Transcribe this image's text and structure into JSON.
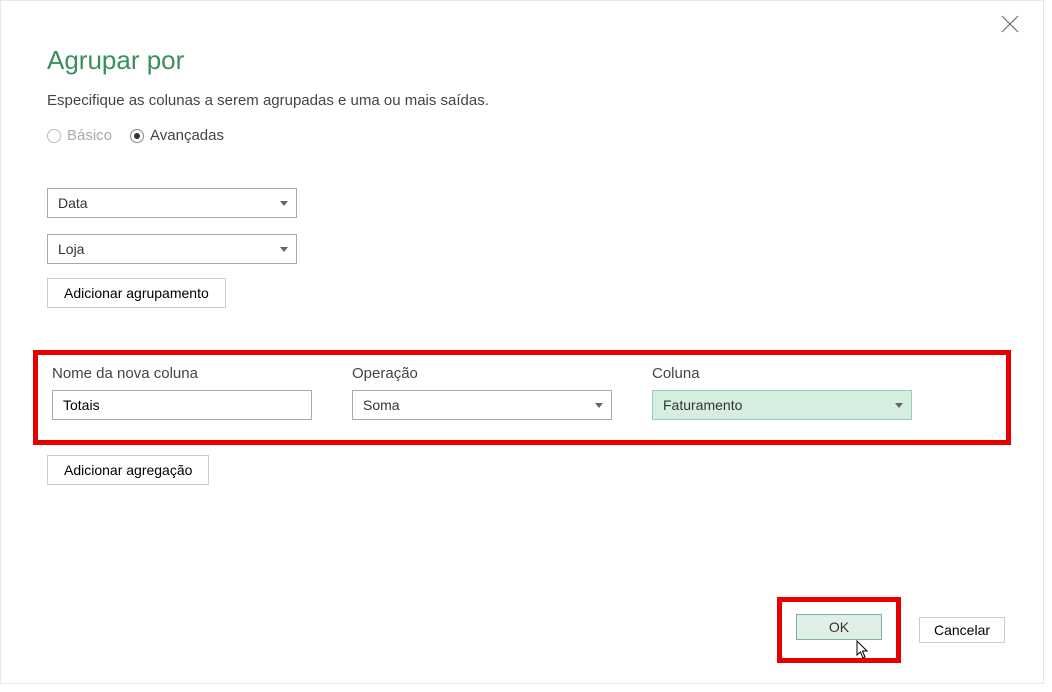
{
  "dialog": {
    "title": "Agrupar por",
    "subtitle": "Especifique as colunas a serem agrupadas e uma ou mais saídas."
  },
  "mode": {
    "basic": "Básico",
    "advanced": "Avançadas",
    "selected": "advanced"
  },
  "groupings": {
    "items": [
      {
        "value": "Data"
      },
      {
        "value": "Loja"
      }
    ],
    "add_label": "Adicionar agrupamento"
  },
  "aggregation": {
    "headers": {
      "name": "Nome da nova coluna",
      "operation": "Operação",
      "column": "Coluna"
    },
    "row": {
      "name_value": "Totais",
      "operation_value": "Soma",
      "column_value": "Faturamento"
    },
    "add_label": "Adicionar agregação"
  },
  "buttons": {
    "ok": "OK",
    "cancel": "Cancelar"
  }
}
